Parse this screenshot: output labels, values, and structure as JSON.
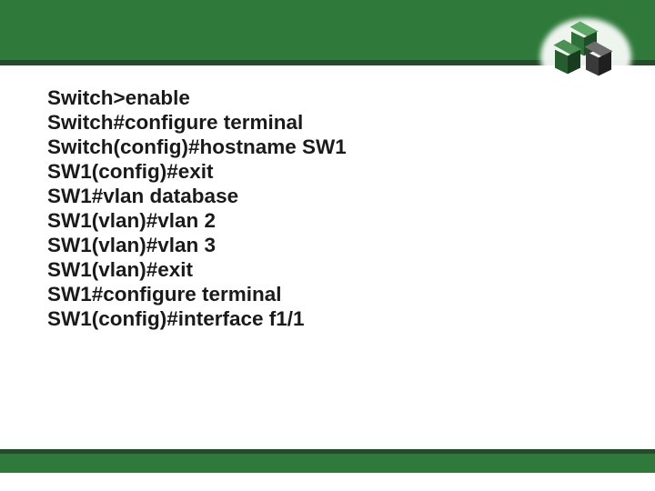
{
  "colors": {
    "green": "#2f7a3a",
    "dark_green": "#224d28",
    "text": "#1a1a1a",
    "white": "#ffffff"
  },
  "logo": {
    "description": "three-isometric-cubes-icon",
    "cubes": [
      "green",
      "green",
      "dark-grey"
    ]
  },
  "terminal_lines": [
    "Switch>enable",
    "Switch#configure terminal",
    "Switch(config)#hostname SW1",
    "SW1(config)#exit",
    "SW1#vlan database",
    "SW1(vlan)#vlan 2",
    "SW1(vlan)#vlan 3",
    "SW1(vlan)#exit",
    "SW1#configure terminal",
    "SW1(config)#interface f1/1"
  ]
}
